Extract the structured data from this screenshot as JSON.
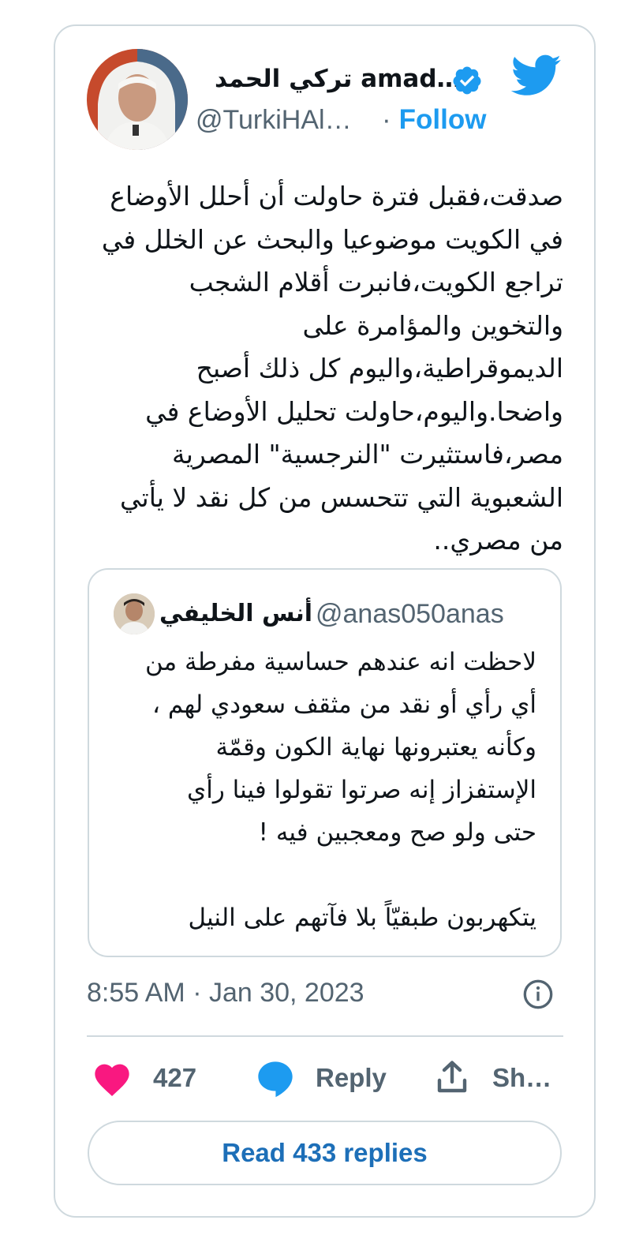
{
  "author": {
    "display_name": "تركي الحمد amad…",
    "handle": "@TurkiHAl…",
    "follow_label": "Follow",
    "follow_separator": "·"
  },
  "tweet": {
    "lines": [
      "صدقت،فقبل فترة حاولت أن أحلل الأوضاع",
      "في الكويت موضوعيا والبحث عن الخلل في",
      "تراجع الكويت،فانبرت أقلام الشجب",
      "والتخوين والمؤامرة على",
      "الديموقراطية،واليوم كل ذلك أصبح",
      "واضحا.واليوم،حاولت تحليل الأوضاع في",
      "مصر،فاستثيرت \"النرجسية\" المصرية",
      "الشعبوية التي تتحسس من كل نقد لا يأتي",
      "من مصري.."
    ],
    "timestamp": "8:55 AM · Jan 30, 2023"
  },
  "quoted": {
    "display_name": "أنس الخليفي",
    "handle": "@anas050anas",
    "lines": [
      "لاحظت انه عندهم حساسية مفرطة من",
      "أي رأي أو نقد من مثقف سعودي لهم ،",
      "وكأنه يعتبرونها نهاية الكون وقمّة",
      "الإستفزاز إنه صرتوا تقولوا فينا رأي",
      "حتى ولو صح ومعجبين فيه !",
      "",
      "يتكهربون طبقيّاً بلا فآتهم على النيل"
    ]
  },
  "actions": {
    "like_count": "427",
    "reply_label": "Reply",
    "share_label": "Sh…",
    "read_replies_label": "Read 433 replies"
  },
  "colors": {
    "accent": "#1d9bf0",
    "like": "#f91880",
    "text_secondary": "#536471",
    "border": "#cfd9de"
  },
  "icons": [
    "twitter-bird-icon",
    "verified-badge-icon",
    "info-icon",
    "heart-icon",
    "reply-bubble-icon",
    "share-icon"
  ]
}
